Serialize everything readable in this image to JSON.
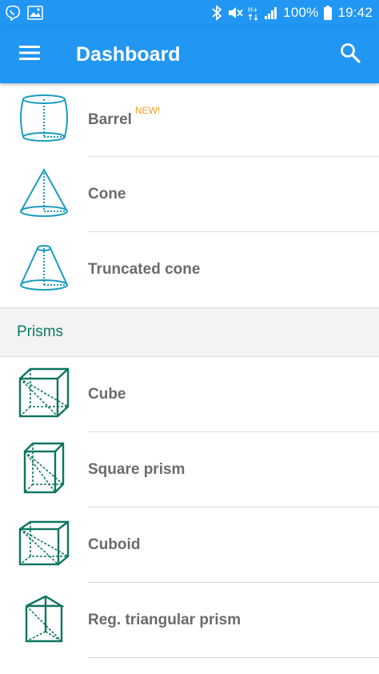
{
  "statusbar": {
    "battery_text": "100%",
    "time": "19:42",
    "left_icons": [
      "viber-icon",
      "gallery-icon"
    ],
    "right_icons": [
      "bluetooth-icon",
      "mute-icon",
      "network-type-icon",
      "signal-icon",
      "battery-icon"
    ]
  },
  "appbar": {
    "title": "Dashboard",
    "menu_icon": "hamburger-menu-icon",
    "search_icon": "search-icon"
  },
  "colors": {
    "primary": "#2196f3",
    "shape_blue": "#1a9cc0",
    "shape_green": "#0e7560",
    "new_badge": "#f0a020",
    "label_gray": "#6b6b6b"
  },
  "items_top": [
    {
      "label": "Barrel",
      "badge": "NEW!",
      "icon": "barrel-shape-icon"
    },
    {
      "label": "Cone",
      "icon": "cone-shape-icon"
    },
    {
      "label": "Truncated cone",
      "icon": "truncated-cone-shape-icon"
    }
  ],
  "section": {
    "title": "Prisms"
  },
  "items_prisms": [
    {
      "label": "Cube",
      "icon": "cube-shape-icon"
    },
    {
      "label": "Square prism",
      "icon": "square-prism-shape-icon"
    },
    {
      "label": "Cuboid",
      "icon": "cuboid-shape-icon"
    },
    {
      "label": "Reg. triangular prism",
      "icon": "triangular-prism-shape-icon"
    }
  ]
}
